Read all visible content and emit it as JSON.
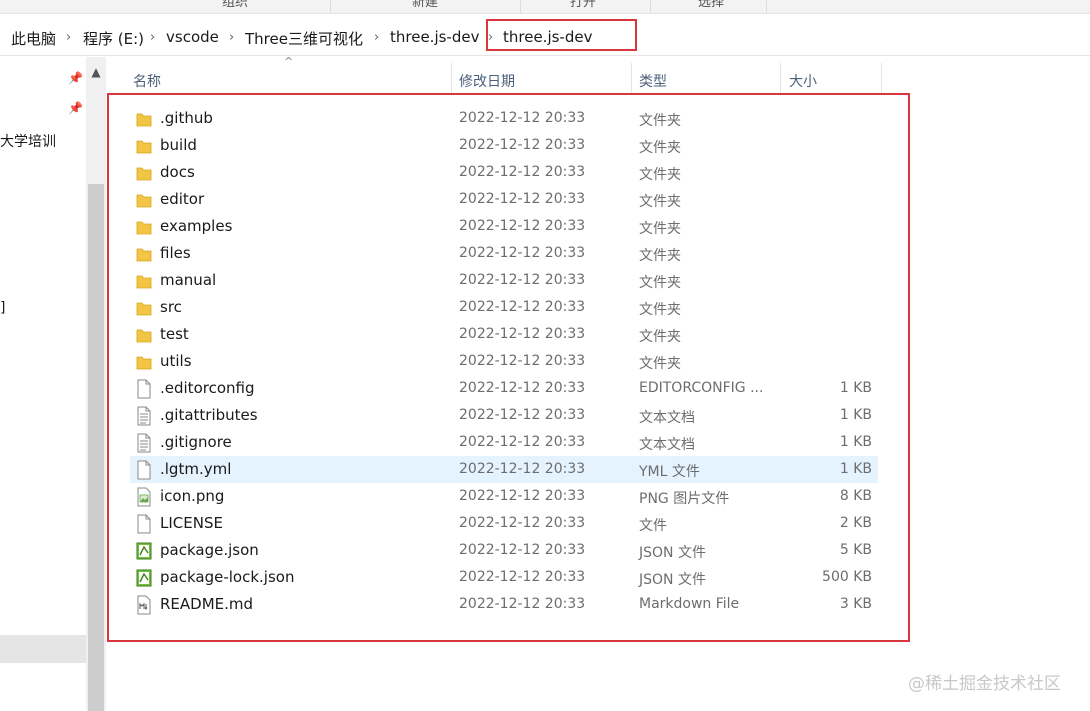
{
  "ribbon": {
    "groups": [
      "组织",
      "新建",
      "打开",
      "选择"
    ]
  },
  "address": {
    "crumbs": [
      "此电脑",
      "程序 (E:)",
      "vscode",
      "Three三维可视化",
      "three.js-dev",
      "three.js-dev"
    ]
  },
  "navpane": {
    "visible_texts": [
      "大学培训",
      "]"
    ]
  },
  "columns": {
    "name": "名称",
    "date": "修改日期",
    "type": "类型",
    "size": "大小"
  },
  "files": [
    {
      "name": ".github",
      "date": "2022-12-12 20:33",
      "type": "文件夹",
      "size": "",
      "icon": "folder-icon"
    },
    {
      "name": "build",
      "date": "2022-12-12 20:33",
      "type": "文件夹",
      "size": "",
      "icon": "folder-icon"
    },
    {
      "name": "docs",
      "date": "2022-12-12 20:33",
      "type": "文件夹",
      "size": "",
      "icon": "folder-icon"
    },
    {
      "name": "editor",
      "date": "2022-12-12 20:33",
      "type": "文件夹",
      "size": "",
      "icon": "folder-icon"
    },
    {
      "name": "examples",
      "date": "2022-12-12 20:33",
      "type": "文件夹",
      "size": "",
      "icon": "folder-icon"
    },
    {
      "name": "files",
      "date": "2022-12-12 20:33",
      "type": "文件夹",
      "size": "",
      "icon": "folder-icon"
    },
    {
      "name": "manual",
      "date": "2022-12-12 20:33",
      "type": "文件夹",
      "size": "",
      "icon": "folder-icon"
    },
    {
      "name": "src",
      "date": "2022-12-12 20:33",
      "type": "文件夹",
      "size": "",
      "icon": "folder-icon"
    },
    {
      "name": "test",
      "date": "2022-12-12 20:33",
      "type": "文件夹",
      "size": "",
      "icon": "folder-icon"
    },
    {
      "name": "utils",
      "date": "2022-12-12 20:33",
      "type": "文件夹",
      "size": "",
      "icon": "folder-icon"
    },
    {
      "name": ".editorconfig",
      "date": "2022-12-12 20:33",
      "type": "EDITORCONFIG ...",
      "size": "1 KB",
      "icon": "blank-file-icon"
    },
    {
      "name": ".gitattributes",
      "date": "2022-12-12 20:33",
      "type": "文本文档",
      "size": "1 KB",
      "icon": "text-file-icon"
    },
    {
      "name": ".gitignore",
      "date": "2022-12-12 20:33",
      "type": "文本文档",
      "size": "1 KB",
      "icon": "text-file-icon"
    },
    {
      "name": ".lgtm.yml",
      "date": "2022-12-12 20:33",
      "type": "YML 文件",
      "size": "1 KB",
      "icon": "blank-file-icon",
      "selected": true
    },
    {
      "name": "icon.png",
      "date": "2022-12-12 20:33",
      "type": "PNG 图片文件",
      "size": "8 KB",
      "icon": "image-file-icon"
    },
    {
      "name": "LICENSE",
      "date": "2022-12-12 20:33",
      "type": "文件",
      "size": "2 KB",
      "icon": "blank-file-icon"
    },
    {
      "name": "package.json",
      "date": "2022-12-12 20:33",
      "type": "JSON 文件",
      "size": "5 KB",
      "icon": "json-file-icon"
    },
    {
      "name": "package-lock.json",
      "date": "2022-12-12 20:33",
      "type": "JSON 文件",
      "size": "500 KB",
      "icon": "json-file-icon"
    },
    {
      "name": "README.md",
      "date": "2022-12-12 20:33",
      "type": "Markdown File",
      "size": "3 KB",
      "icon": "markdown-file-icon"
    }
  ],
  "watermark": "@稀土掘金技术社区",
  "colors": {
    "highlight_red": "#d9363e",
    "selected_row": "#e5f3ff",
    "folder_yellow": "#f3c544"
  }
}
